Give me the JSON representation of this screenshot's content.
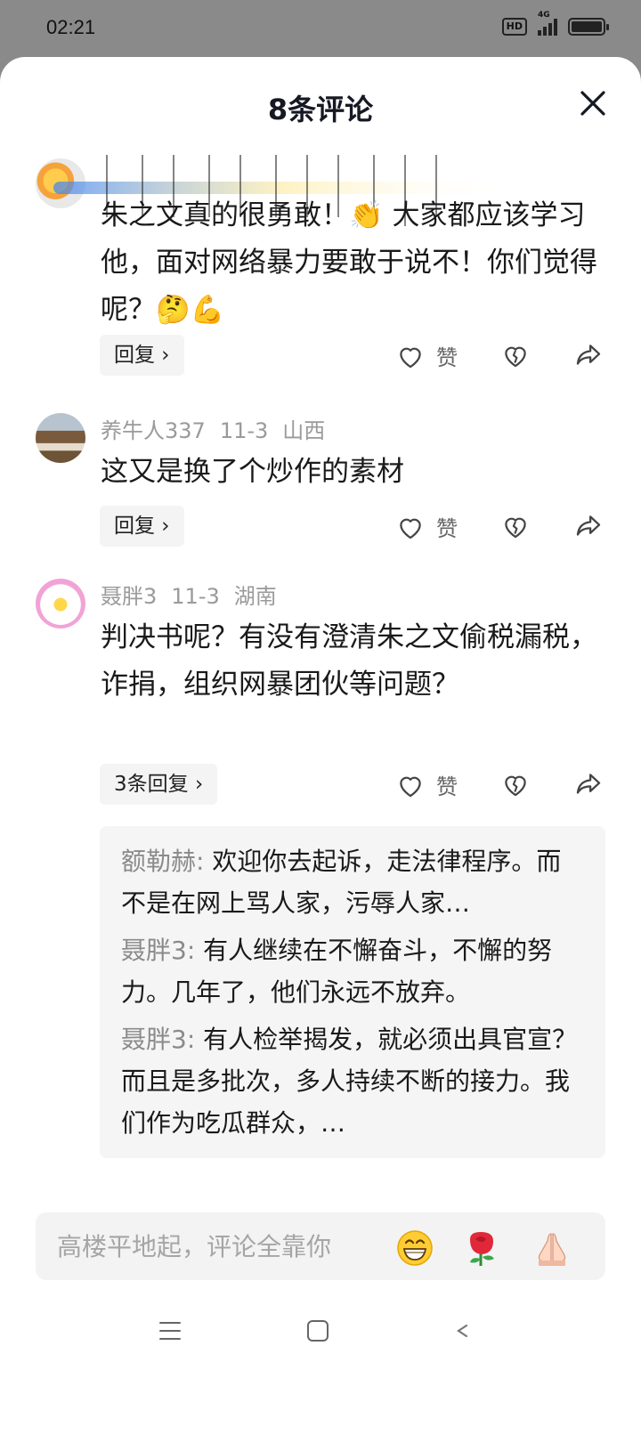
{
  "status_bar": {
    "time": "02:21",
    "hd": "HD",
    "network": "4G"
  },
  "header": {
    "title": "8条评论"
  },
  "comments": [
    {
      "author": "",
      "date": "",
      "region": "",
      "text": "朱之文真的很勇敢！👏 大家都应该学习他，面对网络暴力要敢于说不！你们觉得呢？🤔💪",
      "reply_label": "回复 ›",
      "like_label": "赞"
    },
    {
      "author": "养牛人337",
      "date": "11-3",
      "region": "山西",
      "text": "这又是换了个炒作的素材",
      "reply_label": "回复 ›",
      "like_label": "赞"
    },
    {
      "author": "聂胖3",
      "date": "11-3",
      "region": "湖南",
      "text": "判决书呢？有没有澄清朱之文偷税漏税，诈捐，组织网暴团伙等问题？",
      "reply_label": "3条回复 ›",
      "like_label": "赞",
      "replies": [
        {
          "author": "额勒赫:",
          "text": " 欢迎你去起诉，走法律程序。而不是在网上骂人家，污辱人家…"
        },
        {
          "author": "聂胖3:",
          "text": " 有人继续在不懈奋斗，不懈的努力。几年了，他们永远不放弃。"
        },
        {
          "author": "聂胖3:",
          "text": " 有人检举揭发，就必须出具官宣？而且是多批次，多人持续不断的接力。我们作为吃瓜群众，…"
        }
      ]
    }
  ],
  "input": {
    "placeholder": "高楼平地起，评论全靠你"
  },
  "emoji_buttons": [
    "grinning-emoji",
    "rose-emoji",
    "folded-hands-emoji"
  ]
}
